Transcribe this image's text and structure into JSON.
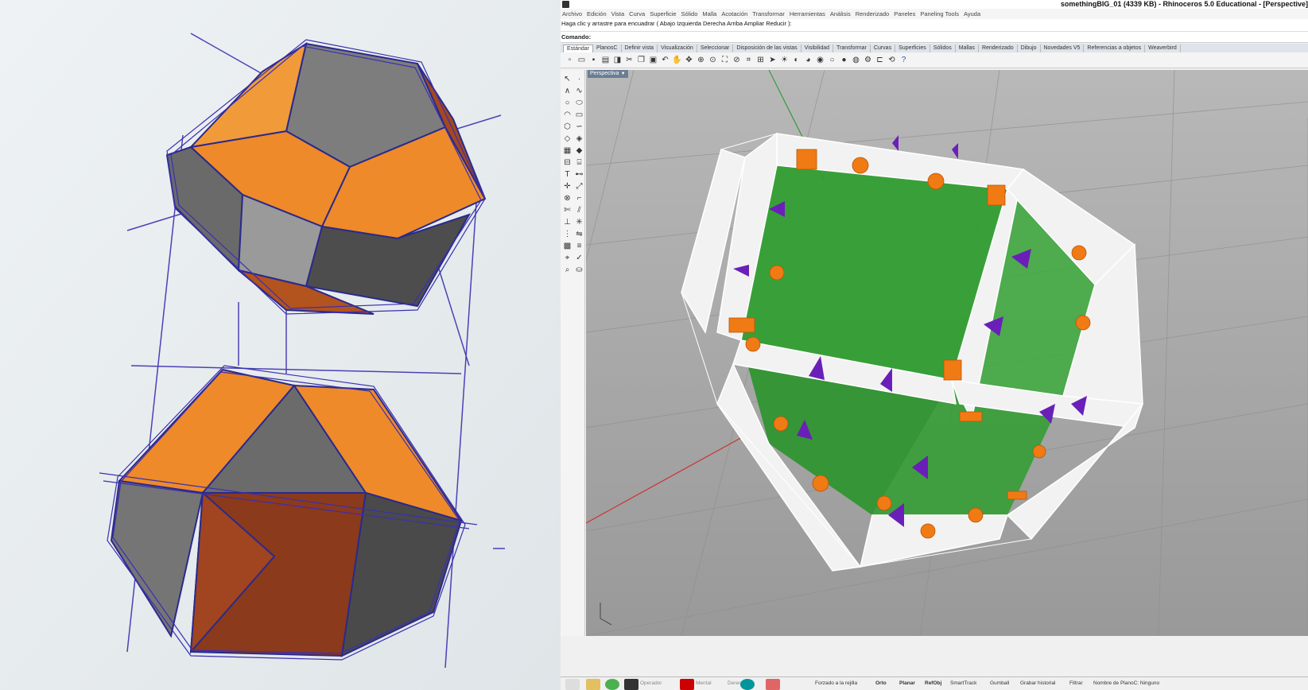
{
  "window": {
    "title": "somethingBIG_01 (4339 KB) - Rhinoceros 5.0 Educational - [Perspective]"
  },
  "menu": [
    "Archivo",
    "Edición",
    "Vista",
    "Curva",
    "Superficie",
    "Sólido",
    "Malla",
    "Acotación",
    "Transformar",
    "Herramientas",
    "Análisis",
    "Renderizado",
    "Paneles",
    "Paneling Tools",
    "Ayuda"
  ],
  "command_history": "Haga clic y arrastre para encuadrar ( Abajo  Izquierda  Derecha  Arriba  Ampliar  Reducir ):",
  "command": {
    "label": "Comando:",
    "value": ""
  },
  "tabs": [
    "Estándar",
    "PlanosC",
    "Definir vista",
    "Visualización",
    "Seleccionar",
    "Disposición de las vistas",
    "Visibilidad",
    "Transformar",
    "Curvas",
    "Superficies",
    "Sólidos",
    "Mallas",
    "Renderizado",
    "Dibujo",
    "Novedades V5",
    "Referencias a objetos",
    "Weaverbird"
  ],
  "viewport": {
    "label": "Perspectiva"
  },
  "toolbar_icons": [
    "new-file-icon",
    "open-file-icon",
    "save-icon",
    "print-icon",
    "import-icon",
    "cut-icon",
    "copy-icon",
    "paste-icon",
    "undo-icon",
    "pan-icon",
    "rotate-view-icon",
    "zoom-in-icon",
    "zoom-window-icon",
    "zoom-extents-icon",
    "zoom-selected-icon",
    "grid-icon",
    "named-views-icon",
    "select-icon",
    "lights-icon",
    "shade-icon",
    "render-icon",
    "material-icon",
    "ghosted-icon",
    "xray-icon",
    "sphere-icon",
    "options-icon",
    "dimension-icon",
    "history-icon",
    "help-icon"
  ],
  "colors": {
    "viewport_bg": "#a5a5a5",
    "panel_green": "#2f9e2f",
    "frame_white": "#f2f2f2",
    "bolt_orange": "#f07a14",
    "wedge_purple": "#6a1fb8",
    "sketch_orange": "#ee8a2a",
    "sketch_grey": "#5e5e5e",
    "sketch_brown": "#8b3a1c",
    "sketch_ink": "#3b2fb0"
  },
  "statusbar": {
    "taskbar_apps": [
      "start-icon",
      "explorer-icon",
      "chrome-icon",
      "rhino-icon",
      "acrobat-icon",
      "arduino-icon",
      "word-icon"
    ],
    "taskbar_texts": [
      "Operador",
      "Mental",
      "Derecha"
    ],
    "items": [
      "Forzado a la rejilla",
      "Orto",
      "Planar",
      "RefObj",
      "SmartTrack",
      "Gumball",
      "Grabar historial",
      "Filtrar",
      "Nombre de PlanoC: Ninguno"
    ]
  }
}
